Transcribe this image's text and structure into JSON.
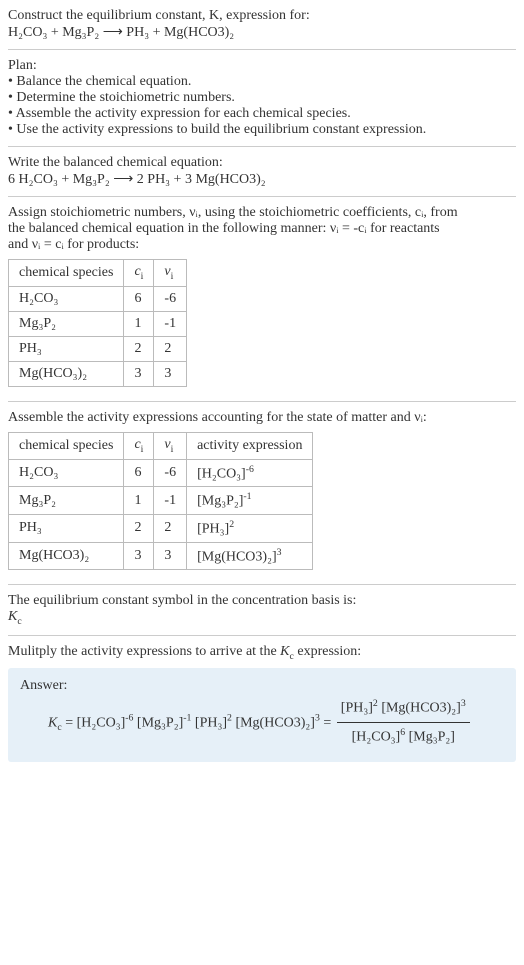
{
  "header": {
    "line1": "Construct the equilibrium constant, K, expression for:",
    "equation_lhs": "H₂CO₃ + Mg₃P₂",
    "equation_arrow": "⟶",
    "equation_rhs": "PH₃ + Mg(HCO3)₂"
  },
  "plan": {
    "title": "Plan:",
    "items": [
      "• Balance the chemical equation.",
      "• Determine the stoichiometric numbers.",
      "• Assemble the activity expression for each chemical species.",
      "• Use the activity expressions to build the equilibrium constant expression."
    ]
  },
  "balanced": {
    "title": "Write the balanced chemical equation:",
    "equation": "6 H₂CO₃ + Mg₃P₂  ⟶  2 PH₃ + 3 Mg(HCO3)₂"
  },
  "assign": {
    "intro1": "Assign stoichiometric numbers, νᵢ, using the stoichiometric coefficients, cᵢ, from",
    "intro2": "the balanced chemical equation in the following manner: νᵢ = -cᵢ for reactants",
    "intro3": "and νᵢ = cᵢ for products:"
  },
  "table1": {
    "headers": [
      "chemical species",
      "cᵢ",
      "νᵢ"
    ],
    "rows": [
      [
        "H₂CO₃",
        "6",
        "-6"
      ],
      [
        "Mg₃P₂",
        "1",
        "-1"
      ],
      [
        "PH₃",
        "2",
        "2"
      ],
      [
        "Mg(HCO₃)₂",
        "3",
        "3"
      ]
    ]
  },
  "assemble": {
    "title": "Assemble the activity expressions accounting for the state of matter and νᵢ:"
  },
  "table2": {
    "headers": [
      "chemical species",
      "cᵢ",
      "νᵢ",
      "activity expression"
    ],
    "rows": [
      {
        "sp": "H₂CO₃",
        "c": "6",
        "v": "-6",
        "base": "[H₂CO₃]",
        "exp": "-6"
      },
      {
        "sp": "Mg₃P₂",
        "c": "1",
        "v": "-1",
        "base": "[Mg₃P₂]",
        "exp": "-1"
      },
      {
        "sp": "PH₃",
        "c": "2",
        "v": "2",
        "base": "[PH₃]",
        "exp": "2"
      },
      {
        "sp": "Mg(HCO3)₂",
        "c": "3",
        "v": "3",
        "base": "[Mg(HCO3)₂]",
        "exp": "3"
      }
    ]
  },
  "symbol": {
    "line1": "The equilibrium constant symbol in the concentration basis is:",
    "line2": "K𝒸"
  },
  "multiply": {
    "title": "Mulitply the activity expressions to arrive at the K𝒸 expression:"
  },
  "answer": {
    "label": "Answer:",
    "lhs": "K𝒸 = [H₂CO₃]⁻⁶ [Mg₃P₂]⁻¹ [PH₃]² [Mg(HCO3)₂]³ =",
    "num": "[PH₃]² [Mg(HCO3)₂]³",
    "den": "[H₂CO₃]⁶ [Mg₃P₂]"
  },
  "chart_data": {
    "type": "table",
    "tables": [
      {
        "title": "Stoichiometric numbers",
        "columns": [
          "chemical species",
          "c_i",
          "nu_i"
        ],
        "rows": [
          [
            "H2CO3",
            6,
            -6
          ],
          [
            "Mg3P2",
            1,
            -1
          ],
          [
            "PH3",
            2,
            2
          ],
          [
            "Mg(HCO3)2",
            3,
            3
          ]
        ]
      },
      {
        "title": "Activity expressions",
        "columns": [
          "chemical species",
          "c_i",
          "nu_i",
          "activity expression"
        ],
        "rows": [
          [
            "H2CO3",
            6,
            -6,
            "[H2CO3]^-6"
          ],
          [
            "Mg3P2",
            1,
            -1,
            "[Mg3P2]^-1"
          ],
          [
            "PH3",
            2,
            2,
            "[PH3]^2"
          ],
          [
            "Mg(HCO3)2",
            3,
            3,
            "[Mg(HCO3)2]^3"
          ]
        ]
      }
    ]
  }
}
